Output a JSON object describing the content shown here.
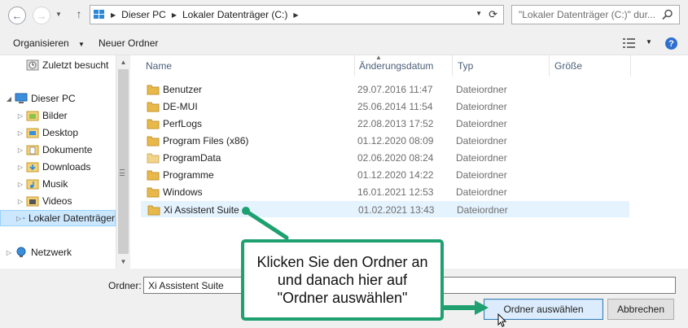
{
  "address_bar": {
    "breadcrumbs": [
      "Dieser PC",
      "Lokaler Datenträger (C:)"
    ],
    "search_placeholder": "\"Lokaler Datenträger (C:)\" dur..."
  },
  "toolbar": {
    "organize_label": "Organisieren",
    "new_folder_label": "Neuer Ordner"
  },
  "nav_pane": {
    "items": [
      {
        "label": "Zuletzt besucht",
        "icon": "recent-icon",
        "level": 1
      },
      {
        "label": "Dieser PC",
        "icon": "computer-icon",
        "level": 0,
        "expanded": true
      },
      {
        "label": "Bilder",
        "icon": "pictures-folder-icon",
        "level": 1
      },
      {
        "label": "Desktop",
        "icon": "desktop-folder-icon",
        "level": 1
      },
      {
        "label": "Dokumente",
        "icon": "documents-folder-icon",
        "level": 1
      },
      {
        "label": "Downloads",
        "icon": "downloads-folder-icon",
        "level": 1
      },
      {
        "label": "Musik",
        "icon": "music-folder-icon",
        "level": 1
      },
      {
        "label": "Videos",
        "icon": "videos-folder-icon",
        "level": 1
      },
      {
        "label": "Lokaler Datenträger",
        "icon": "drive-icon",
        "level": 1,
        "selected": true
      },
      {
        "label": "Netzwerk",
        "icon": "network-icon",
        "level": 0
      }
    ]
  },
  "file_list": {
    "columns": [
      "Name",
      "Änderungsdatum",
      "Typ",
      "Größe"
    ],
    "rows": [
      {
        "name": "Benutzer",
        "date": "29.07.2016 11:47",
        "type": "Dateiordner"
      },
      {
        "name": "DE-MUI",
        "date": "25.06.2014 11:54",
        "type": "Dateiordner"
      },
      {
        "name": "PerfLogs",
        "date": "22.08.2013 17:52",
        "type": "Dateiordner"
      },
      {
        "name": "Program Files (x86)",
        "date": "01.12.2020 08:09",
        "type": "Dateiordner"
      },
      {
        "name": "ProgramData",
        "date": "02.06.2020 08:24",
        "type": "Dateiordner"
      },
      {
        "name": "Programme",
        "date": "01.12.2020 14:22",
        "type": "Dateiordner"
      },
      {
        "name": "Windows",
        "date": "16.01.2021 12:53",
        "type": "Dateiordner"
      },
      {
        "name": "Xi Assistent Suite",
        "date": "01.02.2021 13:43",
        "type": "Dateiordner",
        "selected": true
      }
    ]
  },
  "footer": {
    "folder_label": "Ordner:",
    "folder_value": "Xi Assistent Suite",
    "select_button": "Ordner auswählen",
    "cancel_button": "Abbrechen"
  },
  "callout": {
    "text": "Klicken Sie den Ordner an und danach hier auf \"Ordner auswählen\"",
    "color": "#1ea070"
  },
  "colors": {
    "selection": "#cce8ff",
    "row_highlight": "#e5f3ff",
    "header_text": "#4c607a",
    "folder": "#e8b84a"
  }
}
